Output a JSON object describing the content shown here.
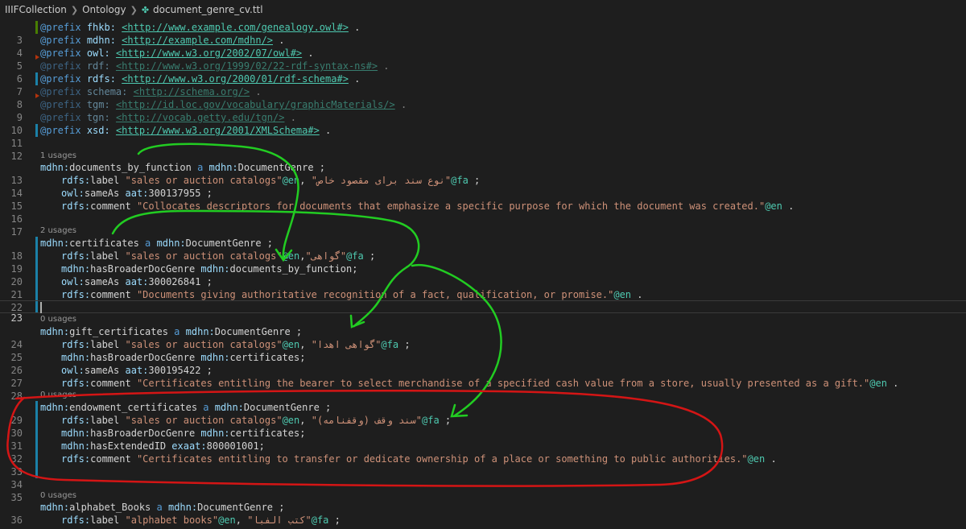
{
  "breadcrumb": {
    "items": [
      "IIIFCollection",
      "Ontology",
      "document_genre_cv.ttl"
    ],
    "file_icon": "turtle-file-icon"
  },
  "annotation_colors": {
    "green": "#22cc22",
    "red": "#d41515"
  },
  "lines": {
    "l3": {
      "num": "3",
      "prefix": "@prefix",
      "ns": "fhkb:",
      "uri": "<http://www.example.com/genealogy.owl#>",
      "end": " ."
    },
    "l4": {
      "num": "4",
      "prefix": "@prefix",
      "ns": "mdhn:",
      "uri": "<http://example.com/mdhn/>",
      "end": " ."
    },
    "l5": {
      "num": "5",
      "prefix": "@prefix",
      "ns": "owl:",
      "uri": "<http://www.w3.org/2002/07/owl#>",
      "end": " ."
    },
    "l6": {
      "num": "6",
      "prefix": "@prefix",
      "ns": "rdf:",
      "uri": "<http://www.w3.org/1999/02/22-rdf-syntax-ns#>",
      "end": " ."
    },
    "l7": {
      "num": "7",
      "prefix": "@prefix",
      "ns": "rdfs:",
      "uri": "<http://www.w3.org/2000/01/rdf-schema#>",
      "end": " ."
    },
    "l8": {
      "num": "8",
      "prefix": "@prefix",
      "ns": "schema:",
      "uri": "<http://schema.org/>",
      "end": " ."
    },
    "l9": {
      "num": "9",
      "prefix": "@prefix",
      "ns": "tgm:",
      "uri": "<http://id.loc.gov/vocabulary/graphicMaterials/>",
      "end": " ."
    },
    "l10": {
      "num": "10",
      "prefix": "@prefix",
      "ns": "tgn:",
      "uri": "<http://vocab.getty.edu/tgn/>",
      "end": " ."
    },
    "l11": {
      "num": "11",
      "prefix": "@prefix",
      "ns": "xsd:",
      "uri": "<http://www.w3.org/2001/XMLSchema#>",
      "end": " ."
    },
    "l12": {
      "num": "12"
    },
    "lens13": "1 usages",
    "l13": {
      "num": "13",
      "ns": "mdhn:",
      "subj": "documents_by_function",
      "a": " a ",
      "tns": "mdhn:",
      "type": "DocumentGenre",
      "end": " ;"
    },
    "l14": {
      "num": "14",
      "pred_ns": "rdfs:",
      "pred": "label",
      "sp": " ",
      "s1": "\"sales or auction catalogs\"",
      "l1": "@en",
      "mid": ", ",
      "s2": "\"نوع سند برای مقصود خاص\"",
      "l2": "@fa",
      "end": " ;"
    },
    "l15": {
      "num": "15",
      "pred_ns": "owl:",
      "pred": "sameAs",
      "sp": " ",
      "vns": "aat:",
      "val": "300137955",
      "end": " ;"
    },
    "l16": {
      "num": "16",
      "pred_ns": "rdfs:",
      "pred": "comment",
      "sp": " ",
      "s1": "\"Collocates descriptors for documents that emphasize a specific purpose for which the document was created.\"",
      "l1": "@en",
      "end": " ."
    },
    "l17": {
      "num": "17"
    },
    "lens18": "2 usages",
    "l18": {
      "num": "18",
      "ns": "mdhn:",
      "subj": "certificates",
      "a": " a ",
      "tns": "mdhn:",
      "type": "DocumentGenre",
      "end": " ;"
    },
    "l19": {
      "num": "19",
      "pred_ns": "rdfs:",
      "pred": "label",
      "sp": " ",
      "s1": "\"sales or auction catalogs\"",
      "l1": "@en",
      "mid": ",",
      "s2": "\"گواهی\"",
      "l2": "@fa",
      "end": " ;"
    },
    "l20": {
      "num": "20",
      "pred_ns": "mdhn:",
      "pred": "hasBroaderDocGenre",
      "sp": " ",
      "vns": "mdhn:",
      "val": "documents_by_function",
      "end": ";"
    },
    "l21": {
      "num": "21",
      "pred_ns": "owl:",
      "pred": "sameAs",
      "sp": " ",
      "vns": "aat:",
      "val": "300026841",
      "end": " ;"
    },
    "l22": {
      "num": "22",
      "pred_ns": "rdfs:",
      "pred": "comment",
      "sp": " ",
      "s1": "\"Documents giving authoritative recognition of a fact, qualification, or promise.\"",
      "l1": "@en",
      "end": " ."
    },
    "l23": {
      "num": "23"
    },
    "lens24": "0 usages",
    "l24": {
      "num": "24",
      "ns": "mdhn:",
      "subj": "gift_certificates",
      "a": " a ",
      "tns": "mdhn:",
      "type": "DocumentGenre",
      "end": " ;"
    },
    "l25": {
      "num": "25",
      "pred_ns": "rdfs:",
      "pred": "label",
      "sp": " ",
      "s1": "\"sales or auction catalogs\"",
      "l1": "@en",
      "mid": ", ",
      "s2": "\"گواهی اهدا\"",
      "l2": "@fa",
      "end": " ;"
    },
    "l26": {
      "num": "26",
      "pred_ns": "mdhn:",
      "pred": "hasBroaderDocGenre",
      "sp": " ",
      "vns": "mdhn:",
      "val": "certificates",
      "end": ";"
    },
    "l27": {
      "num": "27",
      "pred_ns": "owl:",
      "pred": "sameAs",
      "sp": " ",
      "vns": "aat:",
      "val": "300195422",
      "end": " ;"
    },
    "l28": {
      "num": "28",
      "pred_ns": "rdfs:",
      "pred": "comment",
      "sp": " ",
      "s1": "\"Certificates entitling the bearer to select merchandise of a specified cash value from a store, usually presented as a gift.\"",
      "l1": "@en",
      "end": " ."
    },
    "lens29": "0 usages",
    "l29": {
      "num": "29",
      "ns": "mdhn:",
      "subj": "endowment_certificates",
      "a": " a ",
      "tns": "mdhn:",
      "type": "DocumentGenre",
      "end": " ;"
    },
    "l30": {
      "num": "30",
      "pred_ns": "rdfs:",
      "pred": "label",
      "sp": " ",
      "s1": "\"sales or auction catalogs\"",
      "l1": "@en",
      "mid": ", ",
      "s2": "\"سند وقف (وقفنامه)\"",
      "l2": "@fa",
      "end": " ;"
    },
    "l31": {
      "num": "31",
      "pred_ns": "mdhn:",
      "pred": "hasBroaderDocGenre",
      "sp": " ",
      "vns": "mdhn:",
      "val": "certificates",
      "end": ";"
    },
    "l32": {
      "num": "32",
      "pred_ns": "mdhn:",
      "pred": "hasExtendedID",
      "sp": " ",
      "vns": "exaat:",
      "val": "800001001",
      "end": ";"
    },
    "l33": {
      "num": "33",
      "pred_ns": "rdfs:",
      "pred": "comment",
      "sp": " ",
      "s1": "\"Certificates entitling to transfer or dedicate ownership of a place or something to public authorities.\"",
      "l1": "@en",
      "end": " ."
    },
    "l34": {
      "num": "34"
    },
    "l35": {
      "num": "35"
    },
    "lens36": "0 usages",
    "l36": {
      "num": "36",
      "ns": "mdhn:",
      "subj": "alphabet_Books",
      "a": " a ",
      "tns": "mdhn:",
      "type": "DocumentGenre",
      "end": " ;"
    },
    "l37": {
      "num": "37",
      "pred_ns": "rdfs:",
      "pred": "label",
      "sp": " ",
      "s1": "\"alphabet books\"",
      "l1": "@en",
      "mid": ", ",
      "s2": "\"کتب الفبا\"",
      "l2": "@fa",
      "end": " ;"
    }
  }
}
